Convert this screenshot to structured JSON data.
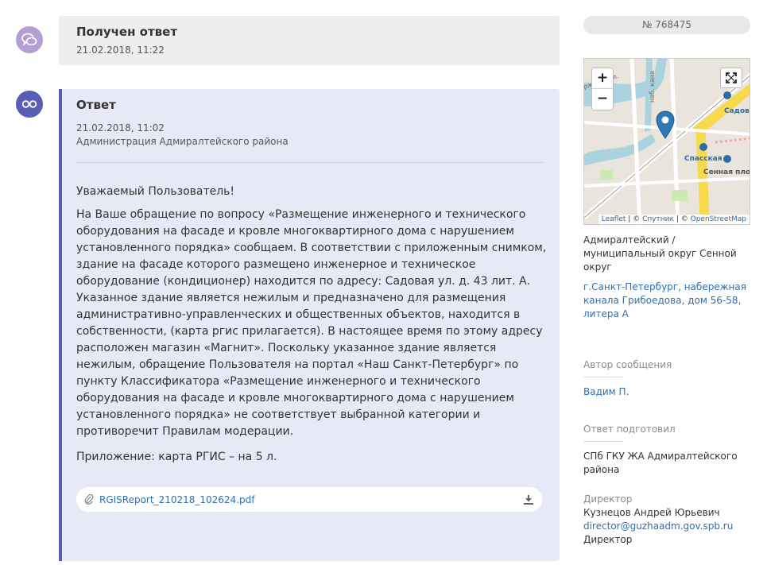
{
  "received": {
    "title": "Получен ответ",
    "date": "21.02.2018, 11:22"
  },
  "answer": {
    "title": "Ответ",
    "date": "21.02.2018, 11:02",
    "org": "Администрация Адмиралтейского района",
    "greeting": "Уважаемый Пользователь!",
    "body": "На Ваше обращение по вопросу «Размещение инженерного и технического оборудования на фасаде и кровле многоквартирного дома с нарушением установленного порядка» сообщаем. В соответствии с приложенным снимком, здание на фасаде которого размещено инженерное и техническое оборудование (кондиционер) находится по адресу: Садовая ул. д. 43 лит. А. Указанное здание является нежилым и предназначено для размещения административно-управленческих и общественных объектов, находится в собственности, (карта ргис прилагается). В настоящее время по этому адресу расположен магазин «Магнит». Поскольку указанное здание является нежилым, обращение Пользователя на портал «Наш Санкт-Петербург» по пункту Классификатора «Размещение инженерного и технического оборудования на фасаде и кровле многоквартирного дома с нарушением установленного порядка» не соответствует выбранной категории и противоречит Правилам модерации.",
    "attachment_note": "Приложение: карта РГИС – на 5 л.",
    "file_name": "RGISReport_210218_102624.pdf"
  },
  "sidebar": {
    "number": "№ 768475",
    "map": {
      "zoom_in": "+",
      "zoom_out": "−",
      "attrib_leaflet": "Leaflet",
      "attrib_sep1": " | © ",
      "attrib_sputnik": "Спутник",
      "attrib_sep2": " | © ",
      "attrib_osm": "OpenStreetMap",
      "labels": [
        "Садова",
        "Спасская",
        "Сенная пло",
        "ржская ул.",
        "наб. кана"
      ]
    },
    "district": "Адмиралтейский / муниципальный округ Сенной округ",
    "address": "г.Санкт-Петербург, набережная канала Грибоедова, дом 56-58, литера А",
    "author_label": "Автор сообщения",
    "author": "Вадим П.",
    "prepared_label": "Ответ подготовил",
    "prepared_org": "СПб ГКУ ЖА Адмиралтейского района",
    "director_label": "Директор",
    "director_name": "Кузнецов Андрей Юрьевич",
    "director_email": "director@guzhaadm.gov.spb.ru",
    "director_title": "Директор"
  },
  "colors": {
    "accent": "#5a5db5",
    "received_avatar": "#b59fd2",
    "link": "#2f6fb0"
  }
}
